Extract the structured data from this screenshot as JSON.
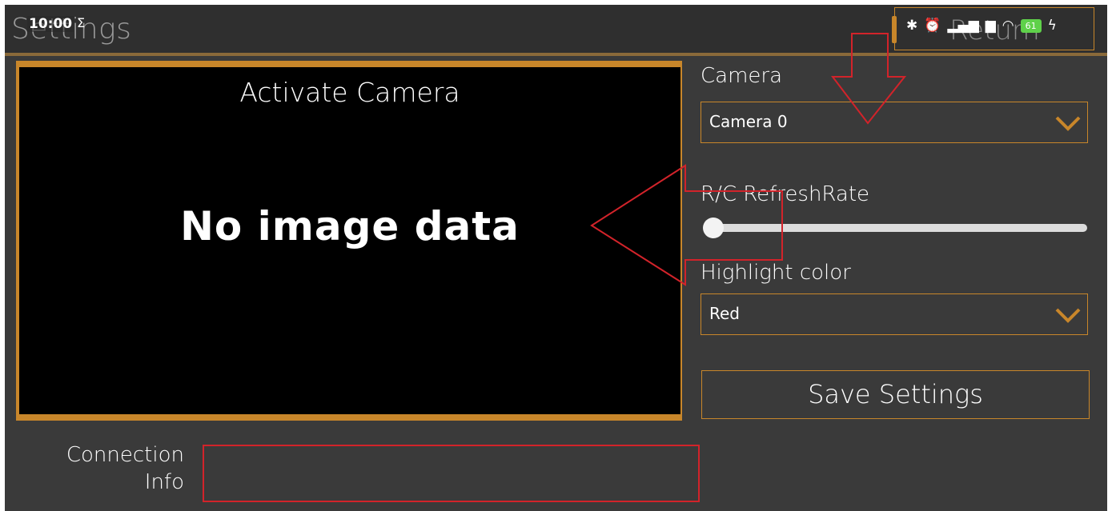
{
  "status_bar": {
    "time": "10:00",
    "sigma": "Σ",
    "battery": "61",
    "icons": [
      "bluetooth-icon",
      "alarm-icon",
      "signal-icon",
      "volte-icon",
      "signal-icon",
      "wifi-icon",
      "battery-icon",
      "charging-icon"
    ]
  },
  "app": {
    "title": "Settings",
    "return_label": "Return"
  },
  "camera_view": {
    "title": "Activate Camera",
    "placeholder": "No image data"
  },
  "settings": {
    "camera_label": "Camera",
    "camera_value": "Camera 0",
    "refresh_label": "R/C RefreshRate",
    "refresh_level": 0,
    "highlight_label": "Highlight color",
    "highlight_value": "Red",
    "save_label": "Save Settings"
  },
  "connection": {
    "label_line1": "Connection",
    "label_line2": "Info",
    "value": ""
  },
  "colors": {
    "accent": "#c8862a",
    "background": "#3a3a3a",
    "annotation": "#d2232a",
    "text": "#ffffff"
  }
}
